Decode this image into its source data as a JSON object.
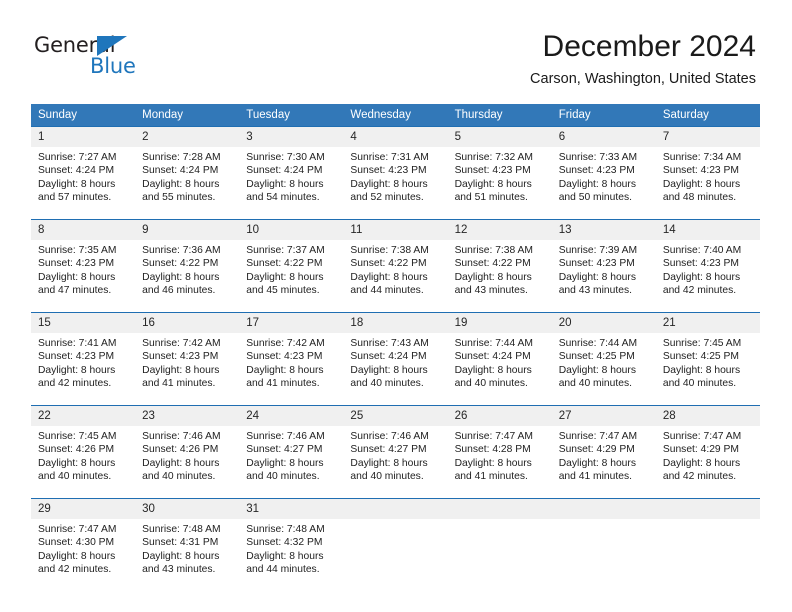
{
  "brand": {
    "name_dark": "General",
    "name_blue": "Blue",
    "accent_color": "#1f76bc"
  },
  "header": {
    "title": "December 2024",
    "subtitle": "Carson, Washington, United States"
  },
  "theme": {
    "header_bg": "#3278b8",
    "row_divider": "#1f6eb2",
    "daynum_bg": "#f0f0f0"
  },
  "calendar": {
    "weekday_headers": [
      "Sunday",
      "Monday",
      "Tuesday",
      "Wednesday",
      "Thursday",
      "Friday",
      "Saturday"
    ],
    "weeks": [
      [
        {
          "day": "1",
          "sunrise": "Sunrise: 7:27 AM",
          "sunset": "Sunset: 4:24 PM",
          "daylight1": "Daylight: 8 hours",
          "daylight2": "and 57 minutes."
        },
        {
          "day": "2",
          "sunrise": "Sunrise: 7:28 AM",
          "sunset": "Sunset: 4:24 PM",
          "daylight1": "Daylight: 8 hours",
          "daylight2": "and 55 minutes."
        },
        {
          "day": "3",
          "sunrise": "Sunrise: 7:30 AM",
          "sunset": "Sunset: 4:24 PM",
          "daylight1": "Daylight: 8 hours",
          "daylight2": "and 54 minutes."
        },
        {
          "day": "4",
          "sunrise": "Sunrise: 7:31 AM",
          "sunset": "Sunset: 4:23 PM",
          "daylight1": "Daylight: 8 hours",
          "daylight2": "and 52 minutes."
        },
        {
          "day": "5",
          "sunrise": "Sunrise: 7:32 AM",
          "sunset": "Sunset: 4:23 PM",
          "daylight1": "Daylight: 8 hours",
          "daylight2": "and 51 minutes."
        },
        {
          "day": "6",
          "sunrise": "Sunrise: 7:33 AM",
          "sunset": "Sunset: 4:23 PM",
          "daylight1": "Daylight: 8 hours",
          "daylight2": "and 50 minutes."
        },
        {
          "day": "7",
          "sunrise": "Sunrise: 7:34 AM",
          "sunset": "Sunset: 4:23 PM",
          "daylight1": "Daylight: 8 hours",
          "daylight2": "and 48 minutes."
        }
      ],
      [
        {
          "day": "8",
          "sunrise": "Sunrise: 7:35 AM",
          "sunset": "Sunset: 4:23 PM",
          "daylight1": "Daylight: 8 hours",
          "daylight2": "and 47 minutes."
        },
        {
          "day": "9",
          "sunrise": "Sunrise: 7:36 AM",
          "sunset": "Sunset: 4:22 PM",
          "daylight1": "Daylight: 8 hours",
          "daylight2": "and 46 minutes."
        },
        {
          "day": "10",
          "sunrise": "Sunrise: 7:37 AM",
          "sunset": "Sunset: 4:22 PM",
          "daylight1": "Daylight: 8 hours",
          "daylight2": "and 45 minutes."
        },
        {
          "day": "11",
          "sunrise": "Sunrise: 7:38 AM",
          "sunset": "Sunset: 4:22 PM",
          "daylight1": "Daylight: 8 hours",
          "daylight2": "and 44 minutes."
        },
        {
          "day": "12",
          "sunrise": "Sunrise: 7:38 AM",
          "sunset": "Sunset: 4:22 PM",
          "daylight1": "Daylight: 8 hours",
          "daylight2": "and 43 minutes."
        },
        {
          "day": "13",
          "sunrise": "Sunrise: 7:39 AM",
          "sunset": "Sunset: 4:23 PM",
          "daylight1": "Daylight: 8 hours",
          "daylight2": "and 43 minutes."
        },
        {
          "day": "14",
          "sunrise": "Sunrise: 7:40 AM",
          "sunset": "Sunset: 4:23 PM",
          "daylight1": "Daylight: 8 hours",
          "daylight2": "and 42 minutes."
        }
      ],
      [
        {
          "day": "15",
          "sunrise": "Sunrise: 7:41 AM",
          "sunset": "Sunset: 4:23 PM",
          "daylight1": "Daylight: 8 hours",
          "daylight2": "and 42 minutes."
        },
        {
          "day": "16",
          "sunrise": "Sunrise: 7:42 AM",
          "sunset": "Sunset: 4:23 PM",
          "daylight1": "Daylight: 8 hours",
          "daylight2": "and 41 minutes."
        },
        {
          "day": "17",
          "sunrise": "Sunrise: 7:42 AM",
          "sunset": "Sunset: 4:23 PM",
          "daylight1": "Daylight: 8 hours",
          "daylight2": "and 41 minutes."
        },
        {
          "day": "18",
          "sunrise": "Sunrise: 7:43 AM",
          "sunset": "Sunset: 4:24 PM",
          "daylight1": "Daylight: 8 hours",
          "daylight2": "and 40 minutes."
        },
        {
          "day": "19",
          "sunrise": "Sunrise: 7:44 AM",
          "sunset": "Sunset: 4:24 PM",
          "daylight1": "Daylight: 8 hours",
          "daylight2": "and 40 minutes."
        },
        {
          "day": "20",
          "sunrise": "Sunrise: 7:44 AM",
          "sunset": "Sunset: 4:25 PM",
          "daylight1": "Daylight: 8 hours",
          "daylight2": "and 40 minutes."
        },
        {
          "day": "21",
          "sunrise": "Sunrise: 7:45 AM",
          "sunset": "Sunset: 4:25 PM",
          "daylight1": "Daylight: 8 hours",
          "daylight2": "and 40 minutes."
        }
      ],
      [
        {
          "day": "22",
          "sunrise": "Sunrise: 7:45 AM",
          "sunset": "Sunset: 4:26 PM",
          "daylight1": "Daylight: 8 hours",
          "daylight2": "and 40 minutes."
        },
        {
          "day": "23",
          "sunrise": "Sunrise: 7:46 AM",
          "sunset": "Sunset: 4:26 PM",
          "daylight1": "Daylight: 8 hours",
          "daylight2": "and 40 minutes."
        },
        {
          "day": "24",
          "sunrise": "Sunrise: 7:46 AM",
          "sunset": "Sunset: 4:27 PM",
          "daylight1": "Daylight: 8 hours",
          "daylight2": "and 40 minutes."
        },
        {
          "day": "25",
          "sunrise": "Sunrise: 7:46 AM",
          "sunset": "Sunset: 4:27 PM",
          "daylight1": "Daylight: 8 hours",
          "daylight2": "and 40 minutes."
        },
        {
          "day": "26",
          "sunrise": "Sunrise: 7:47 AM",
          "sunset": "Sunset: 4:28 PM",
          "daylight1": "Daylight: 8 hours",
          "daylight2": "and 41 minutes."
        },
        {
          "day": "27",
          "sunrise": "Sunrise: 7:47 AM",
          "sunset": "Sunset: 4:29 PM",
          "daylight1": "Daylight: 8 hours",
          "daylight2": "and 41 minutes."
        },
        {
          "day": "28",
          "sunrise": "Sunrise: 7:47 AM",
          "sunset": "Sunset: 4:29 PM",
          "daylight1": "Daylight: 8 hours",
          "daylight2": "and 42 minutes."
        }
      ],
      [
        {
          "day": "29",
          "sunrise": "Sunrise: 7:47 AM",
          "sunset": "Sunset: 4:30 PM",
          "daylight1": "Daylight: 8 hours",
          "daylight2": "and 42 minutes."
        },
        {
          "day": "30",
          "sunrise": "Sunrise: 7:48 AM",
          "sunset": "Sunset: 4:31 PM",
          "daylight1": "Daylight: 8 hours",
          "daylight2": "and 43 minutes."
        },
        {
          "day": "31",
          "sunrise": "Sunrise: 7:48 AM",
          "sunset": "Sunset: 4:32 PM",
          "daylight1": "Daylight: 8 hours",
          "daylight2": "and 44 minutes."
        },
        {
          "day": "",
          "sunrise": "",
          "sunset": "",
          "daylight1": "",
          "daylight2": ""
        },
        {
          "day": "",
          "sunrise": "",
          "sunset": "",
          "daylight1": "",
          "daylight2": ""
        },
        {
          "day": "",
          "sunrise": "",
          "sunset": "",
          "daylight1": "",
          "daylight2": ""
        },
        {
          "day": "",
          "sunrise": "",
          "sunset": "",
          "daylight1": "",
          "daylight2": ""
        }
      ]
    ]
  }
}
